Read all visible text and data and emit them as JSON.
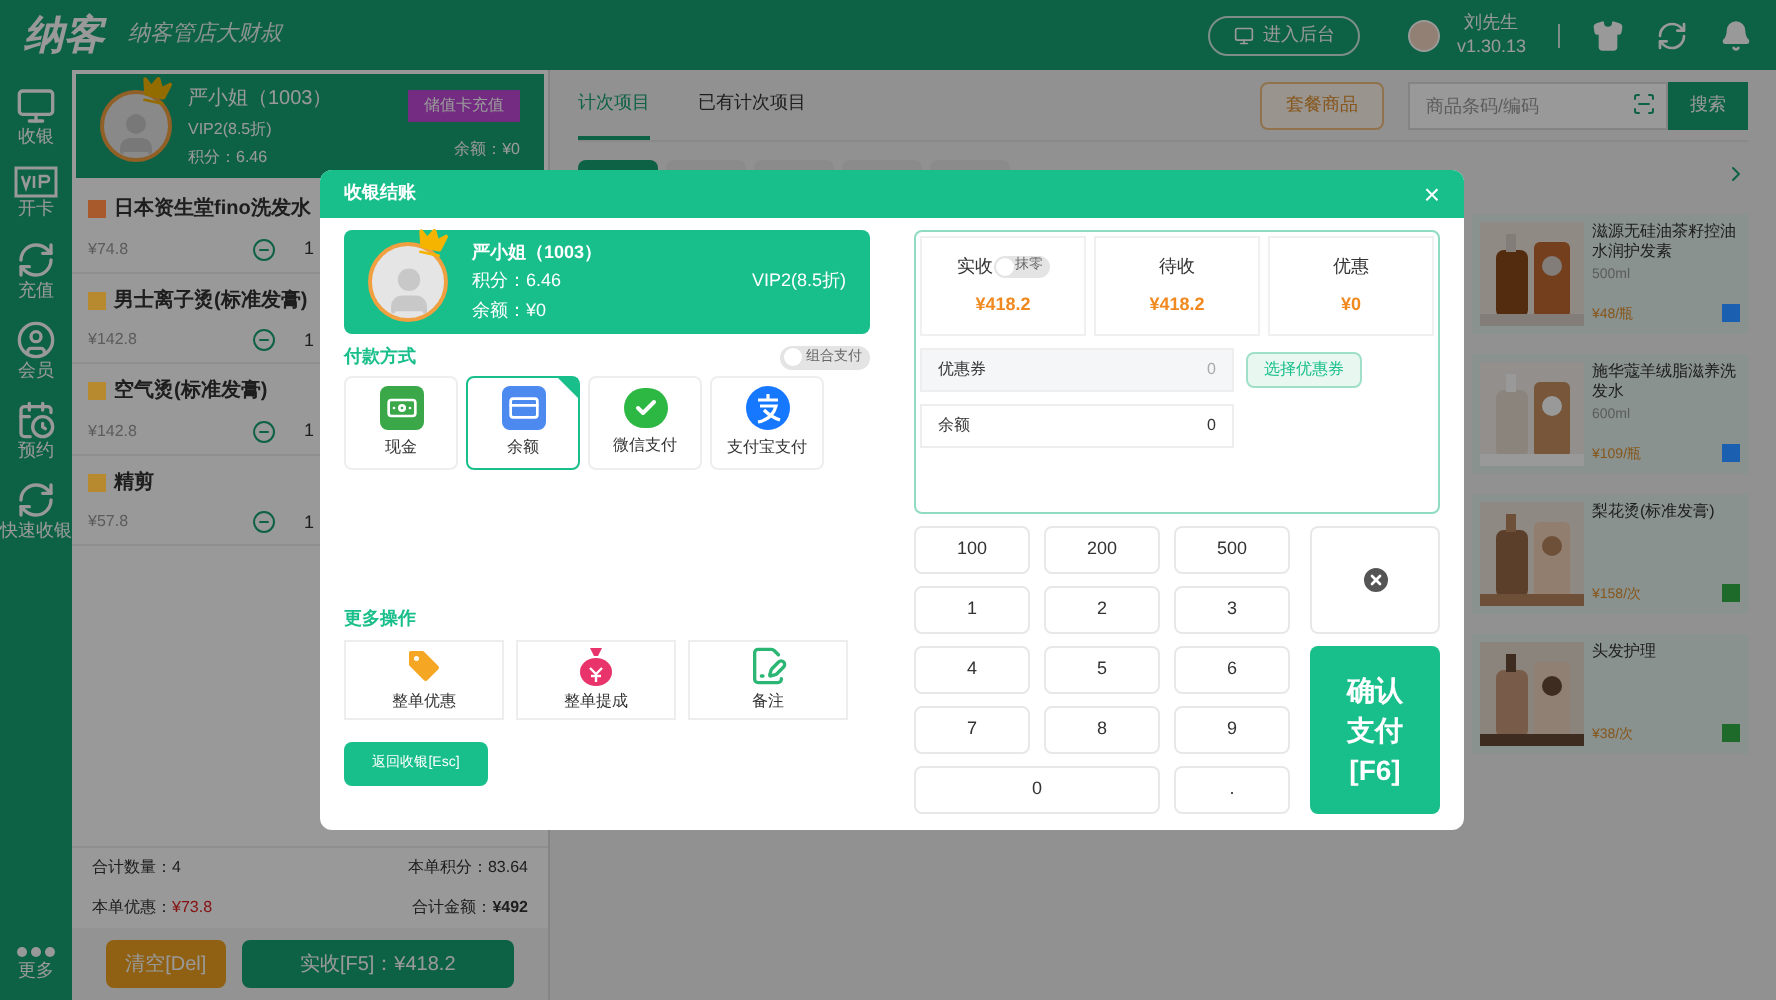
{
  "header": {
    "logo": "纳客",
    "slogan": "纳客管店大财叔",
    "admin_button": "进入后台",
    "user": {
      "name": "刘先生",
      "version": "v1.30.13"
    }
  },
  "sidebar": {
    "items": [
      {
        "label": "收银"
      },
      {
        "label": "开卡"
      },
      {
        "label": "充值"
      },
      {
        "label": "会员"
      },
      {
        "label": "预约"
      },
      {
        "label": "快速收银"
      }
    ],
    "more": "更多"
  },
  "member": {
    "name": "严小姐（1003）",
    "level": "VIP2(8.5折)",
    "points": "积分：6.46",
    "recharge_button": "储值卡充值",
    "balance": "余额：¥0"
  },
  "cart": [
    {
      "name": "日本资生堂fino洗发水",
      "price": "¥74.8",
      "qty": "1",
      "color": "#a85a2c"
    },
    {
      "name": "男士离子烫(标准发膏)",
      "price": "¥142.8",
      "qty": "1",
      "color": "#b88a30"
    },
    {
      "name": "空气烫(标准发膏)",
      "price": "¥142.8",
      "qty": "1",
      "color": "#b88a30"
    },
    {
      "name": "精剪",
      "price": "¥57.8",
      "qty": "1",
      "color": "#b88a30"
    }
  ],
  "totals": {
    "count": "合计数量：4",
    "points": "本单积分：83.64",
    "discount_label": "本单优惠：",
    "discount": "¥73.8",
    "amount_label": "合计金额：",
    "amount": "¥492"
  },
  "cart_buttons": {
    "clear": "清空[Del]",
    "pay": "实收[F5]：¥418.2"
  },
  "tabs": [
    {
      "label": "计次项目",
      "selected": true
    },
    {
      "label": "已有计次项目",
      "selected": false
    }
  ],
  "package_button": "套餐商品",
  "search": {
    "placeholder": "商品条码/编码",
    "button": "搜索"
  },
  "categories": [
    {
      "selected": true
    },
    {
      "selected": false
    },
    {
      "selected": false
    },
    {
      "selected": false
    },
    {
      "selected": false
    }
  ],
  "products": [
    {
      "name": "滋源无硅油茶籽控油水润护发素",
      "spec": "500ml",
      "price": "¥48/瓶",
      "color": "#1a5fb0"
    },
    {
      "name": "施华蔻羊绒脂滋养洗发水",
      "spec": "600ml",
      "price": "¥109/瓶",
      "color": "#1a5fb0"
    },
    {
      "name": "梨花烫(标准发膏)",
      "price": "¥158/次",
      "color": "#1e6a2a"
    },
    {
      "name": "头发护理",
      "price": "¥38/次",
      "color": "#1e6a2a"
    }
  ],
  "dialog": {
    "title": "收银结账",
    "close": "×",
    "member": {
      "name": "严小姐（1003）",
      "points": "积分：6.46",
      "balance": "余额：¥0",
      "level": "VIP2(8.5折)"
    },
    "payment_title": "付款方式",
    "combined_pay": {
      "label": "组合支付",
      "on": false
    },
    "methods": [
      {
        "label": "现金",
        "kind": "cash",
        "selected": false
      },
      {
        "label": "余额",
        "kind": "balance",
        "selected": true
      },
      {
        "label": "微信支付",
        "kind": "wechat",
        "selected": false
      },
      {
        "label": "支付宝支付",
        "kind": "alipay",
        "selected": false
      }
    ],
    "more_title": "更多操作",
    "actions": [
      {
        "label": "整单优惠",
        "kind": "tag"
      },
      {
        "label": "整单提成",
        "kind": "bag"
      },
      {
        "label": "备注",
        "kind": "note"
      }
    ],
    "back_button": "返回收银[Esc]",
    "summary": [
      {
        "label": "实收",
        "value": "¥418.2",
        "toggle": {
          "label": "抹零",
          "on": false
        }
      },
      {
        "label": "待收",
        "value": "¥418.2"
      },
      {
        "label": "优惠",
        "value": "¥0"
      }
    ],
    "coupon": {
      "label": "优惠券",
      "value": "0",
      "disabled": true
    },
    "coupon_button": "选择优惠券",
    "balance_field": {
      "label": "余额",
      "value": "0",
      "disabled": false
    },
    "keys": [
      {
        "label": "100",
        "kind": "key"
      },
      {
        "label": "200",
        "kind": "key"
      },
      {
        "label": "500",
        "kind": "key"
      },
      {
        "label": "1",
        "kind": "key"
      },
      {
        "label": "2",
        "kind": "key"
      },
      {
        "label": "3",
        "kind": "key"
      },
      {
        "label": "4",
        "kind": "key"
      },
      {
        "label": "5",
        "kind": "key"
      },
      {
        "label": "6",
        "kind": "key"
      },
      {
        "label": "7",
        "kind": "key"
      },
      {
        "label": "8",
        "kind": "key"
      },
      {
        "label": "9",
        "kind": "key"
      },
      {
        "label": "0",
        "kind": "wide"
      },
      {
        "label": ".",
        "kind": "key"
      }
    ],
    "confirm_button": [
      "确认",
      "支付",
      "[F6]"
    ]
  }
}
